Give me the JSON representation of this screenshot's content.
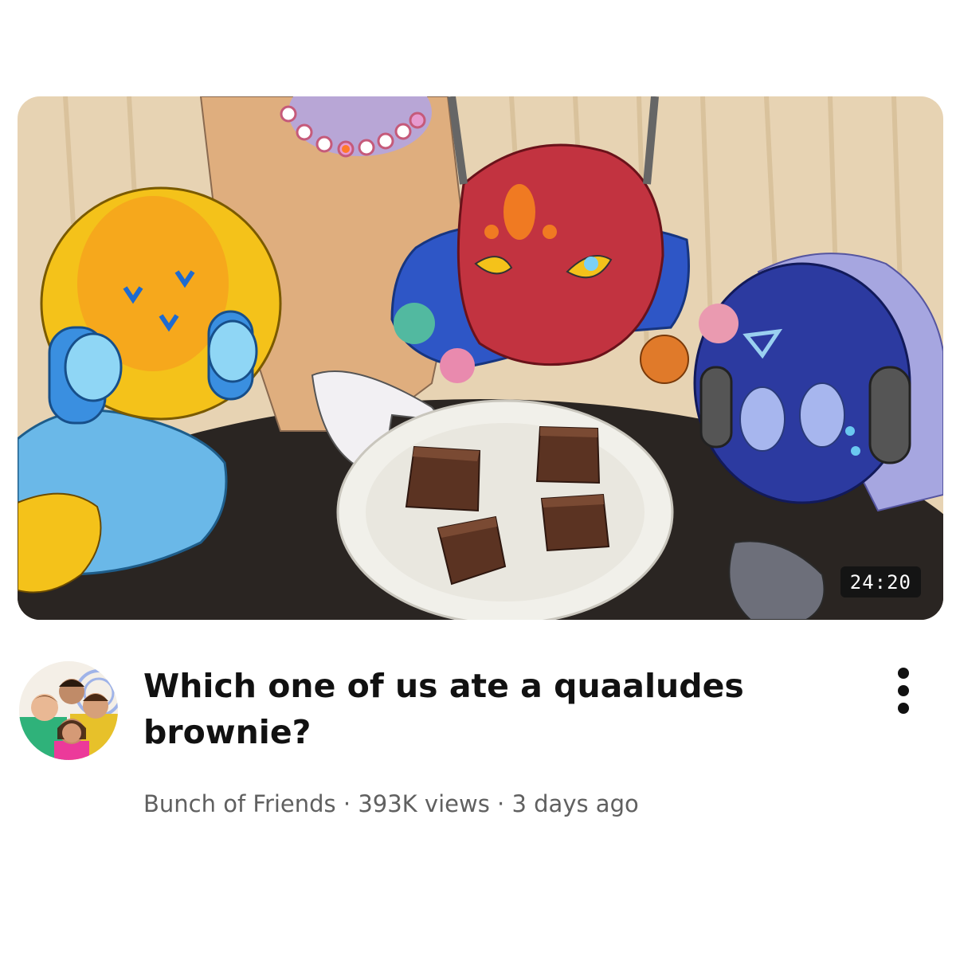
{
  "video": {
    "duration": "24:20",
    "title": "Which one of us ate a quaaludes brownie?",
    "channel": "Bunch of Friends",
    "separator": "·",
    "views": "393K views",
    "age": "3 days ago"
  },
  "icons": {
    "menu": "more-vert-icon"
  },
  "colors": {
    "title": "#111111",
    "meta": "#606060",
    "duration_bg": "#141414"
  }
}
